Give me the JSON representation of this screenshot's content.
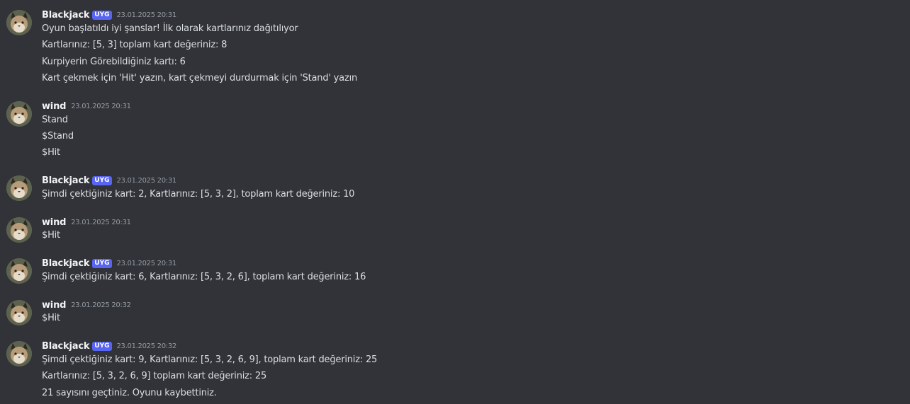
{
  "colors": {
    "background": "#313338",
    "username": "#f2f3f5",
    "text": "#dbdee1",
    "timestamp": "#949ba4",
    "badge": "#5865f2"
  },
  "messages": [
    {
      "author": "Blackjack",
      "badge": "UYG",
      "timestamp": "23.01.2025 20:31",
      "avatar_icon": "lynx-avatar-icon",
      "lines": [
        "Oyun başlatıldı iyi şanslar! İlk olarak kartlarınız dağıtılıyor",
        "Kartlarınız: [5, 3] toplam kart değeriniz: 8",
        "Kurpiyerin Görebildiğiniz kartı: 6",
        "Kart çekmek için 'Hit' yazın, kart çekmeyi durdurmak için 'Stand' yazın"
      ]
    },
    {
      "author": "wind",
      "timestamp": "23.01.2025 20:31",
      "avatar_icon": "lynx-avatar-icon",
      "lines": [
        "Stand",
        "$Stand",
        "$Hit"
      ]
    },
    {
      "author": "Blackjack",
      "badge": "UYG",
      "timestamp": "23.01.2025 20:31",
      "avatar_icon": "lynx-avatar-icon",
      "lines": [
        "Şimdi çektiğiniz kart: 2, Kartlarınız: [5, 3, 2], toplam kart değeriniz: 10"
      ]
    },
    {
      "author": "wind",
      "timestamp": "23.01.2025 20:31",
      "avatar_icon": "lynx-avatar-icon",
      "lines": [
        "$Hit"
      ]
    },
    {
      "author": "Blackjack",
      "badge": "UYG",
      "timestamp": "23.01.2025 20:31",
      "avatar_icon": "lynx-avatar-icon",
      "lines": [
        "Şimdi çektiğiniz kart: 6, Kartlarınız: [5, 3, 2, 6], toplam kart değeriniz: 16"
      ]
    },
    {
      "author": "wind",
      "timestamp": "23.01.2025 20:32",
      "avatar_icon": "lynx-avatar-icon",
      "lines": [
        "$Hit"
      ]
    },
    {
      "author": "Blackjack",
      "badge": "UYG",
      "timestamp": "23.01.2025 20:32",
      "avatar_icon": "lynx-avatar-icon",
      "lines": [
        "Şimdi çektiğiniz kart: 9, Kartlarınız: [5, 3, 2, 6, 9], toplam kart değeriniz: 25",
        "Kartlarınız: [5, 3, 2, 6, 9] toplam kart değeriniz: 25",
        "21 sayısını geçtiniz. Oyunu kaybettiniz."
      ]
    }
  ]
}
